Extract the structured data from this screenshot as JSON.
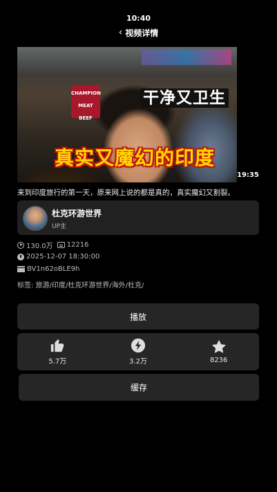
{
  "status_bar": {
    "time": "10:40"
  },
  "header": {
    "back_icon": "chevron-left-icon",
    "title": "视频详情"
  },
  "video": {
    "caption_top": "干净又卫生",
    "caption_bottom": "真实又魔幻的印度",
    "sign_text": [
      "CHAMPION",
      "MEAT",
      "BEEF"
    ],
    "duration": "19:35"
  },
  "description": "来到印度旅行的第一天，原来网上说的都是真的，真实魔幻又割裂。",
  "uploader": {
    "name": "杜克环游世界",
    "role": "UP主"
  },
  "stats": {
    "views": "130.0万",
    "danmaku": "12216",
    "published": "2025-12-07 18:30:00",
    "bvid": "BV1n62oBLE9h"
  },
  "tags": "标签: 旅游/印度/杜克环游世界/海外/杜克/",
  "buttons": {
    "play": "播放",
    "cache": "缓存"
  },
  "actions": [
    {
      "icon": "thumbs-up-icon",
      "count": "5.7万"
    },
    {
      "icon": "coin-icon",
      "count": "3.2万"
    },
    {
      "icon": "star-icon",
      "count": "8236"
    }
  ],
  "colors": {
    "background": "#000000",
    "card": "#262626",
    "caption_yellow": "#ffd800",
    "caption_outline": "#c4150c"
  }
}
